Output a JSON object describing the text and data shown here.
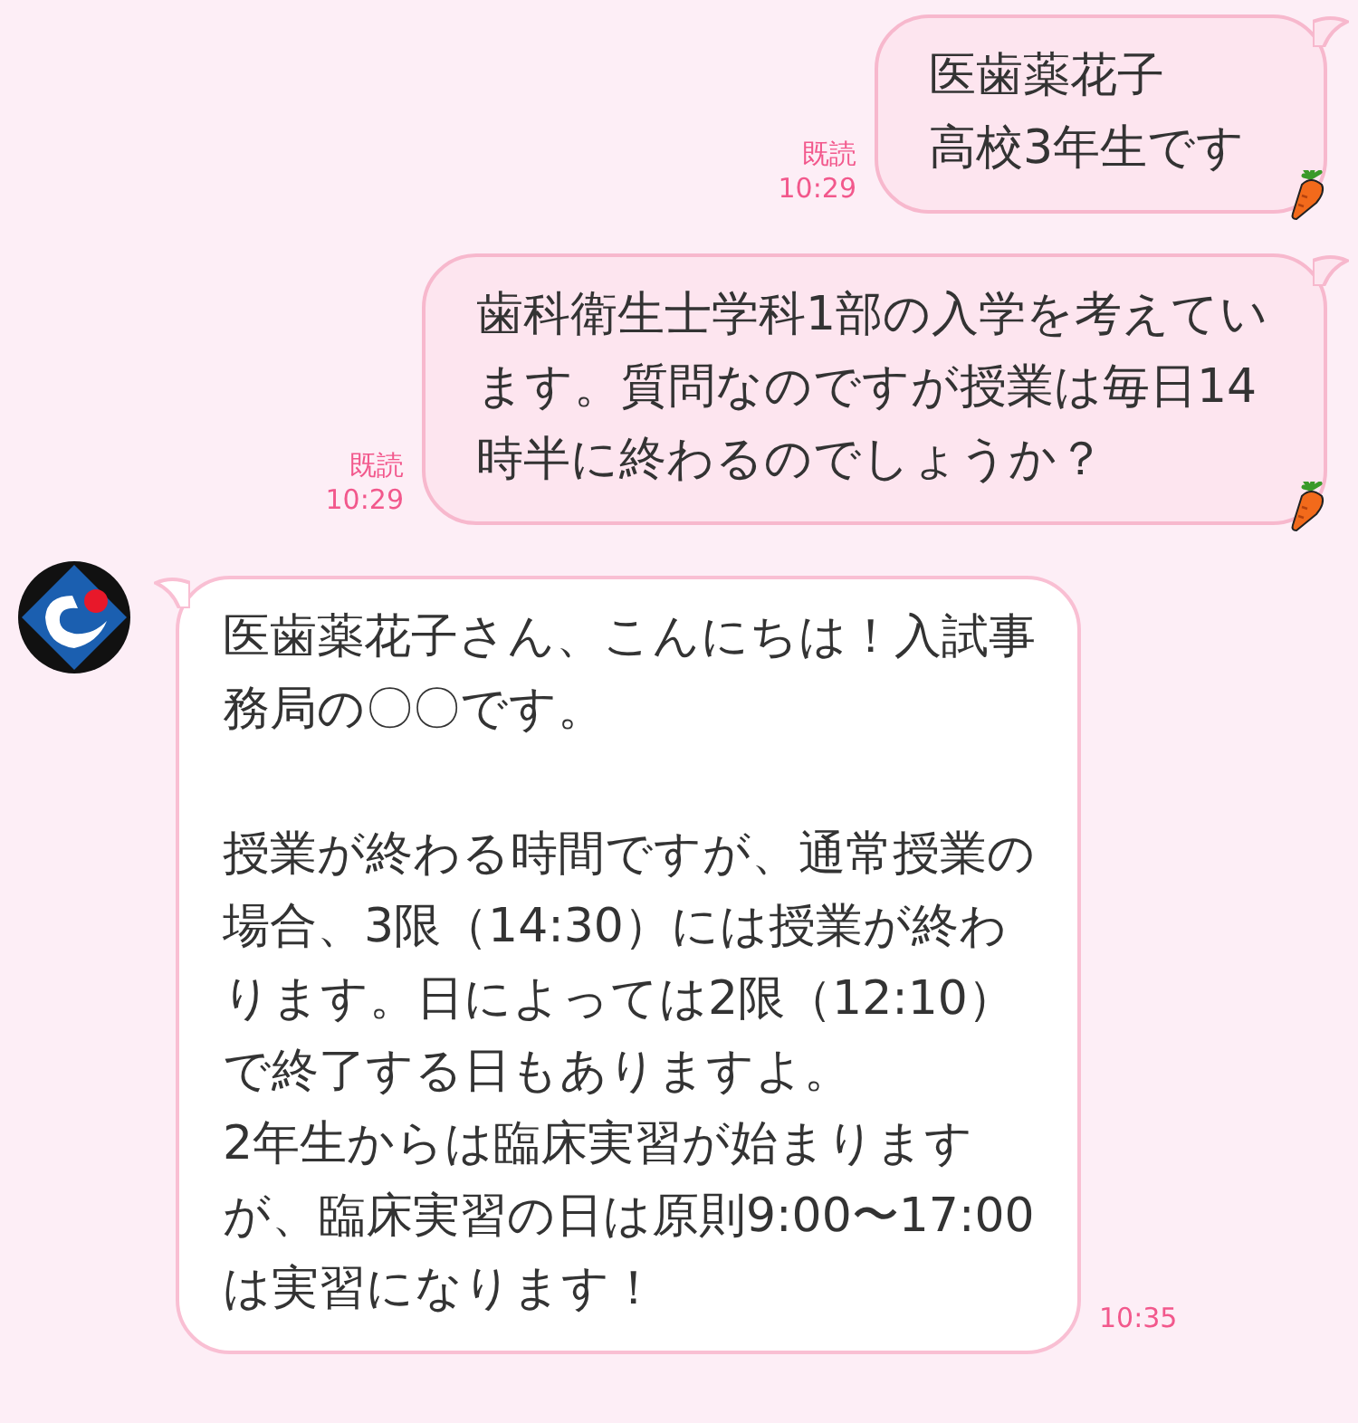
{
  "messages": [
    {
      "kind": "sent",
      "blocks": [
        {
          "lines": [
            "医歯薬花子",
            "高校3年生です"
          ]
        }
      ],
      "read": "既読",
      "time": "10:29"
    },
    {
      "kind": "sent",
      "blocks": [
        {
          "lines": [
            "歯科衛生士学科1部の入学を考えています。質問なのですが授業は毎日14時半に終わるのでしょうか？"
          ]
        }
      ],
      "read": "既読",
      "time": "10:29"
    },
    {
      "kind": "received",
      "blocks": [
        {
          "lines": [
            "医歯薬花子さん、こんにちは！入試事務局の〇〇です。"
          ]
        },
        {
          "lines": [
            "授業が終わる時間ですが、通常授業の場合、3限（14:30）には授業が終わります。日によっては2限（12:10）で終了する日もありますよ。",
            "2年生からは臨床実習が始まりますが、臨床実習の日は原則9:00〜17:00は実習になります！"
          ]
        }
      ],
      "time": "10:35"
    }
  ]
}
